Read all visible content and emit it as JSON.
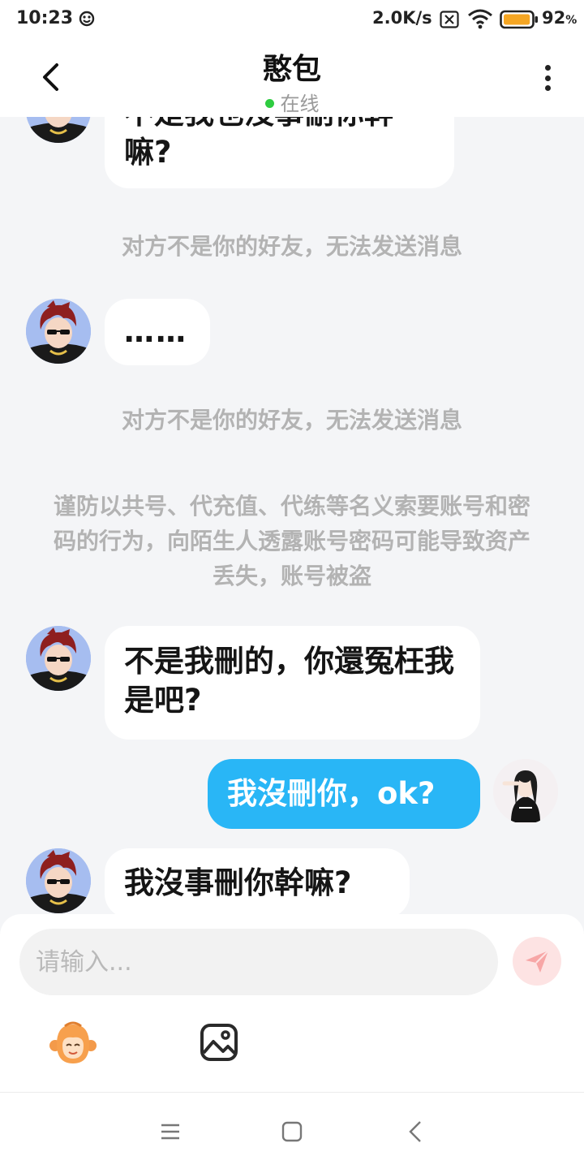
{
  "status_bar": {
    "time": "10:23",
    "net_speed": "2.0K/s",
    "battery_percent": "92",
    "battery_unit": "%",
    "battery_level": 0.92,
    "icons": [
      "notification-icon",
      "sim-x-icon",
      "wifi-icon",
      "battery-icon"
    ]
  },
  "header": {
    "title": "憨包",
    "status": "在线",
    "status_color": "#2ecc40",
    "back_icon": "chevron-left-icon",
    "more_icon": "more-vertical-icon"
  },
  "messages": [
    {
      "from": "other",
      "text": "不是我也沒事刪你幹嘛?"
    },
    {
      "system": "对方不是你的好友，无法发送消息"
    },
    {
      "from": "other",
      "text": "……"
    },
    {
      "system": "对方不是你的好友，无法发送消息"
    },
    {
      "system": "谨防以共号、代充值、代练等名义索要账号和密码的行为，向陌生人透露账号密码可能导致资产丢失，账号被盗"
    },
    {
      "from": "other",
      "text": "不是我刪的，你還冤枉我是吧?"
    },
    {
      "from": "me",
      "text": "我沒刪你，ok?"
    },
    {
      "from": "other",
      "text": "我沒事刪你幹嘛?"
    }
  ],
  "input": {
    "placeholder": "请输入...",
    "value": ""
  },
  "toolbar": {
    "send_icon": "paper-plane-icon",
    "emoji_icon": "monkey-emoji-icon",
    "image_icon": "image-icon"
  },
  "colors": {
    "accent": "#29b6f6",
    "background": "#f4f5f7",
    "bubble_other": "#ffffff",
    "system_text": "#b3b3b3"
  },
  "nav_bar": {
    "icons": [
      "menu-icon",
      "home-square-icon",
      "back-icon"
    ]
  }
}
